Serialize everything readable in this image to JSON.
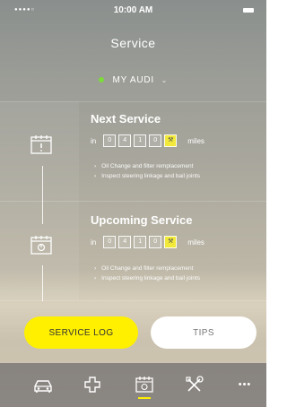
{
  "status": {
    "signal": "●●●●○",
    "time": "10:00 AM"
  },
  "header": {
    "title": "Service"
  },
  "vehicle": {
    "name": "MY AUDI",
    "status_color": "#7bdc3a"
  },
  "next_service": {
    "title": "Next Service",
    "in_label": "in",
    "digits": [
      "0",
      "4",
      "1",
      "0"
    ],
    "units": "miles",
    "items": [
      "Oil Change and filter remplacement",
      "Inspect steering linkage and bail joints"
    ]
  },
  "upcoming_service": {
    "title": "Upcoming Service",
    "in_label": "in",
    "digits": [
      "0",
      "4",
      "1",
      "0"
    ],
    "units": "miles",
    "items": [
      "Oil Change and filter remplacement",
      "Inspect steering linkage and bail joints"
    ]
  },
  "buttons": {
    "service_log": "SERVICE LOG",
    "tips": "TIPS"
  },
  "nav": {
    "items": [
      "car-icon",
      "medical-cross-icon",
      "service-calendar-icon",
      "tools-icon",
      "more-icon"
    ],
    "active_index": 2,
    "more_glyph": "•••"
  },
  "colors": {
    "accent": "#fff000",
    "status": "#7bdc3a"
  }
}
